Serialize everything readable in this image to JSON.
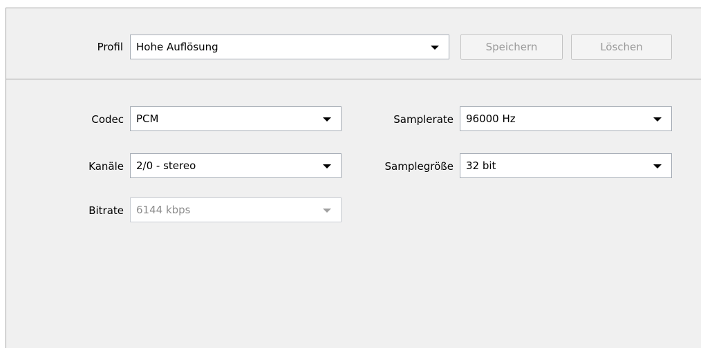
{
  "profile": {
    "label": "Profil",
    "value": "Hohe Auflösung",
    "save_label": "Speichern",
    "delete_label": "Löschen"
  },
  "codec": {
    "label": "Codec",
    "value": "PCM"
  },
  "channels": {
    "label": "Kanäle",
    "value": "2/0 - stereo"
  },
  "bitrate": {
    "label": "Bitrate",
    "value": "6144 kbps",
    "enabled": false
  },
  "samplerate": {
    "label": "Samplerate",
    "value": "96000 Hz"
  },
  "samplesize": {
    "label": "Samplegröße",
    "value": "32 bit"
  },
  "icons": {
    "dropdown": "chevron-down-icon"
  }
}
